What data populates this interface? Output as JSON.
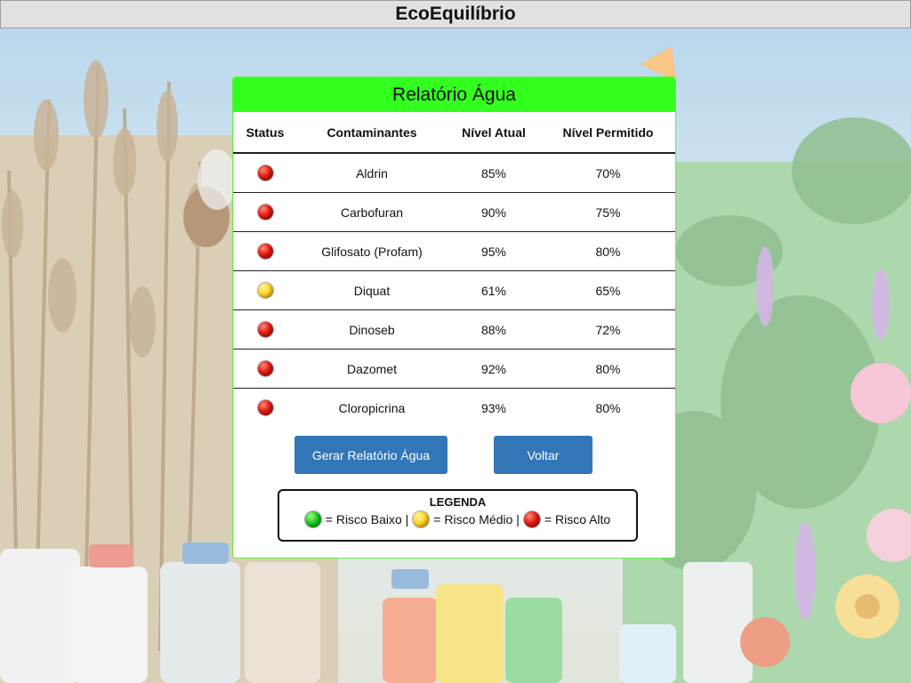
{
  "window": {
    "title": "EcoEquilíbrio"
  },
  "report": {
    "title": "Relatório Água",
    "columns": [
      "Status",
      "Contaminantes",
      "Nível Atual",
      "Nível Permitido"
    ],
    "rows": [
      {
        "status": "red",
        "contaminant": "Aldrin",
        "current": "85%",
        "allowed": "70%"
      },
      {
        "status": "red",
        "contaminant": "Carbofuran",
        "current": "90%",
        "allowed": "75%"
      },
      {
        "status": "red",
        "contaminant": "Glifosato (Profam)",
        "current": "95%",
        "allowed": "80%"
      },
      {
        "status": "yellow",
        "contaminant": "Diquat",
        "current": "61%",
        "allowed": "65%"
      },
      {
        "status": "red",
        "contaminant": "Dinoseb",
        "current": "88%",
        "allowed": "72%"
      },
      {
        "status": "red",
        "contaminant": "Dazomet",
        "current": "92%",
        "allowed": "80%"
      },
      {
        "status": "red",
        "contaminant": "Cloropicrina",
        "current": "93%",
        "allowed": "80%"
      }
    ]
  },
  "actions": {
    "generate_label": "Gerar Relatório Água",
    "back_label": "Voltar"
  },
  "legend": {
    "title": "LEGENDA",
    "low": "= Risco Baixo |",
    "medium": "= Risco Médio |",
    "high": "= Risco Alto"
  },
  "colors": {
    "header_green": "#33ff1f",
    "button_blue": "#3276b8",
    "status_red": "#e41b12",
    "status_yellow": "#ffd21c",
    "status_green": "#17c41a"
  }
}
